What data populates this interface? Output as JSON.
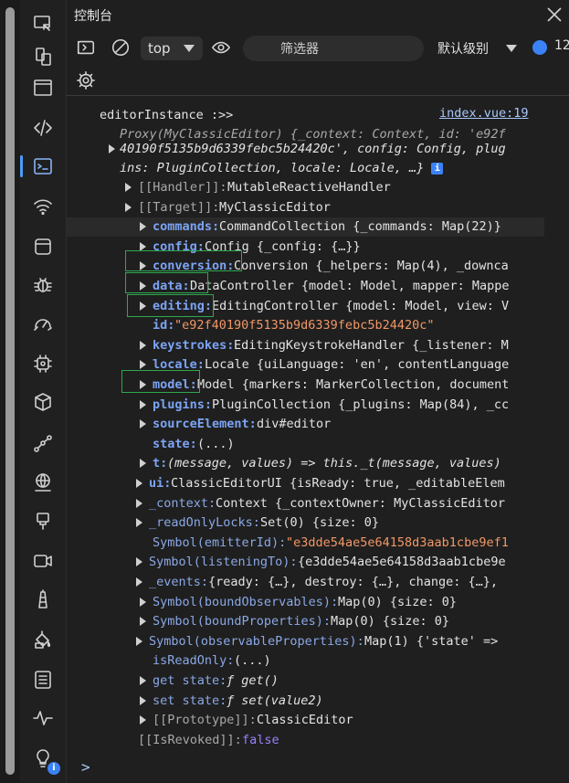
{
  "panel": {
    "title": "控制台"
  },
  "toolbar": {
    "context": "top",
    "filter_placeholder": "筛选器",
    "levels": "默认级别",
    "message_count": "12"
  },
  "console": {
    "header": "editorInstance :>>",
    "source_link": "index.vue:19",
    "proxy_line": "Proxy(MyClassicEditor) {_context: Context, id: 'e92f",
    "proxy_cont_1": "40190f5135b9d6339febc5b24420c', config: Config, plug",
    "proxy_cont_2": "ins: PluginCollection, locale: Locale, …}",
    "handler": [
      "[[Handler]]",
      "MutableReactiveHandler"
    ],
    "target": [
      "[[Target]]",
      "MyClassicEditor"
    ],
    "props": [
      {
        "key": "commands",
        "val": "CommandCollection {_commands: Map(22)}"
      },
      {
        "key": "config",
        "val": "Config {_config: {…}}"
      },
      {
        "key": "conversion",
        "val": "Conversion {_helpers: Map(4), _downca"
      },
      {
        "key": "data",
        "val": "DataController {model: Model, mapper: Mappe"
      },
      {
        "key": "editing",
        "val": "EditingController {model: Model, view: V"
      },
      {
        "key": "id",
        "val": "\"e92f40190f5135b9d6339febc5b24420c\""
      },
      {
        "key": "keystrokes",
        "val": "EditingKeystrokeHandler {_listener: M"
      },
      {
        "key": "locale",
        "val": "Locale {uiLanguage: 'en', contentLanguage"
      },
      {
        "key": "model",
        "val": "Model {markers: MarkerCollection, document"
      },
      {
        "key": "plugins",
        "val": "PluginCollection {_plugins: Map(84), _cc"
      },
      {
        "key": "sourceElement",
        "val": "div#editor"
      },
      {
        "key": "state",
        "val": "(...)"
      },
      {
        "key": "t",
        "val": "(message, values) => this._t(message, values)"
      },
      {
        "key": "ui",
        "val": "ClassicEditorUI {isReady: true, _editableElem"
      },
      {
        "key": "_context",
        "val": "Context {_contextOwner: MyClassicEditor"
      },
      {
        "key": "_readOnlyLocks",
        "val": "Set(0) {size: 0}"
      },
      {
        "key": "Symbol(emitterId)",
        "val": "\"e3dde54ae5e64158d3aab1cbe9ef1"
      },
      {
        "key": "Symbol(listeningTo)",
        "val": "{e3dde54ae5e64158d3aab1cbe9e"
      },
      {
        "key": "_events",
        "val": "{ready: {…}, destroy: {…}, change: {…},"
      },
      {
        "key": "Symbol(boundObservables)",
        "val": "Map(0) {size: 0}"
      },
      {
        "key": "Symbol(boundProperties)",
        "val": "Map(0) {size: 0}"
      },
      {
        "key": "Symbol(observableProperties)",
        "val": "Map(1) {'state' =>"
      },
      {
        "key": "isReadOnly",
        "val": "(...)"
      },
      {
        "key": "get state",
        "val": "ƒ get()"
      },
      {
        "key": "set state",
        "val": "ƒ set(value2)"
      },
      {
        "key": "[[Prototype]]",
        "val": "ClassicEditor"
      }
    ],
    "revoked": [
      "[[IsRevoked]]",
      "false"
    ],
    "prompt": ">"
  },
  "icons": {
    "activity": [
      "device-inspect-icon",
      "device-mirror-icon",
      "window-icon",
      "code-icon",
      "console-icon",
      "wifi-icon",
      "application-icon",
      "bug-icon",
      "performance-icon",
      "memory-chip-icon",
      "cube-icon",
      "graph-icon",
      "network-globe-icon",
      "plug-icon",
      "video-icon",
      "lighthouse-icon",
      "paint-bucket-icon",
      "list-icon",
      "pulse-icon",
      "lightbulb-icon"
    ]
  },
  "colors": {
    "background": "#1f1f1f",
    "accent": "#4c9cf8",
    "green_box": "#2fa84f"
  }
}
